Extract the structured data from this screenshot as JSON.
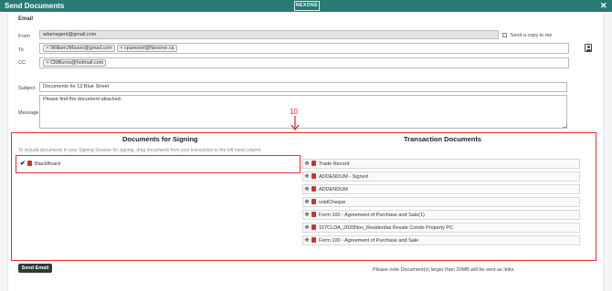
{
  "window": {
    "title": "Send Documents",
    "logo": "NEXONE",
    "close_glyph": "✕"
  },
  "email_section": {
    "label": "Email"
  },
  "from": {
    "label": "From",
    "value": "adamagent@gmail.com"
  },
  "copy_to_me": {
    "label": "Send a copy to me",
    "checked": false
  },
  "to": {
    "label": "To",
    "recipients": [
      "WilliamJMason@gmail.com",
      "cpamorel@Nexone.ca"
    ]
  },
  "cc": {
    "label": "CC",
    "recipients": [
      "CMBurns@hotmail.com"
    ]
  },
  "subject": {
    "label": "Subject",
    "value": "Documents for 12 Blue Street"
  },
  "message": {
    "label": "Message",
    "value": "Please find the document attached."
  },
  "annotation": {
    "number": "10",
    "color": "#d02b2b"
  },
  "signing": {
    "heading": "Documents for Signing",
    "hint": "To include documents in your Signing Session for signing, drag documents from your transaction to the left hand column.",
    "items": [
      {
        "name": "BlackBoard"
      }
    ]
  },
  "transaction": {
    "heading": "Transaction Documents",
    "items": [
      {
        "name": "Trade Record"
      },
      {
        "name": "ADDENDUM - Signed"
      },
      {
        "name": "ADDENDUM"
      },
      {
        "name": "voidCheque"
      },
      {
        "name": "Form 100 - Agreement of Purchase and Sale(1)"
      },
      {
        "name": "157CLDA_2020Nov_Residential Resale Condo Property PC"
      },
      {
        "name": "Form 100 - Agreement of Purchase and Sale"
      }
    ]
  },
  "actions": {
    "send_label": "Send Email"
  },
  "footnote": "Please note Document(s) larger than 20MB will be sent as links.",
  "colors": {
    "titlebar": "#2a7a74",
    "highlight": "#e03030",
    "button": "#2b3b38"
  }
}
